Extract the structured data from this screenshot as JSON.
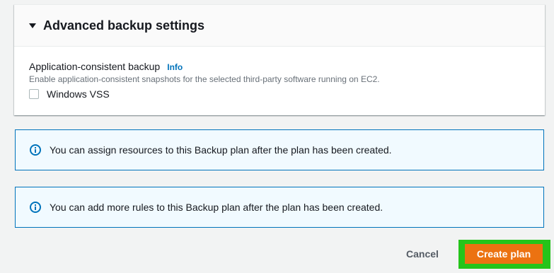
{
  "panel": {
    "title": "Advanced backup settings",
    "field_label": "Application-consistent backup",
    "info_link": "Info",
    "description": "Enable application-consistent snapshots for the selected third-party software running on EC2.",
    "checkbox_label": "Windows VSS",
    "checkbox_checked": false
  },
  "alerts": [
    {
      "text": "You can assign resources to this Backup plan after the plan has been created.",
      "icon": "info-icon"
    },
    {
      "text": "You can add more rules to this Backup plan after the plan has been created.",
      "icon": "info-icon"
    }
  ],
  "footer": {
    "cancel_label": "Cancel",
    "create_label": "Create plan"
  },
  "colors": {
    "background": "#f2f3f3",
    "primary_button": "#ec7211",
    "link": "#0073bb",
    "alert_border": "#0073bb",
    "alert_background": "#f1faff",
    "highlight": "#25c41a"
  }
}
